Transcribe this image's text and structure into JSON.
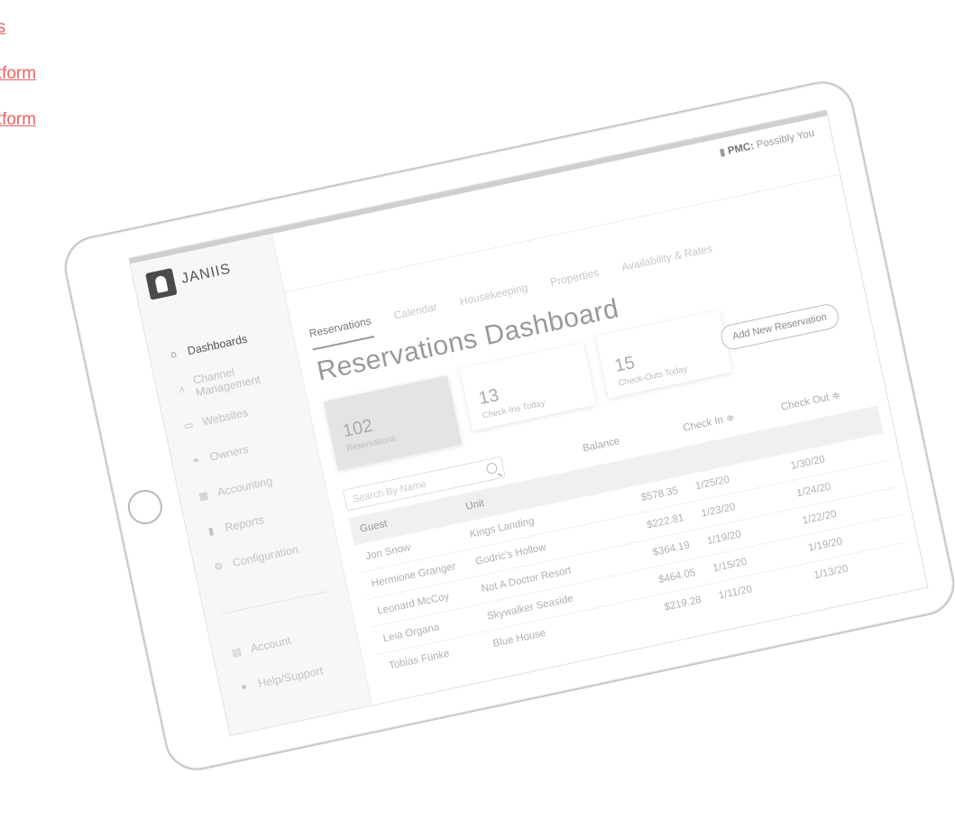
{
  "side_links": [
    "sts",
    "latform",
    "latform"
  ],
  "app": {
    "logo_text": "JANIIS",
    "pmc_label": "PMC:",
    "pmc_value": "Possibly You"
  },
  "sidebar": {
    "items": [
      {
        "label": "Dashboards",
        "icon": "home-icon",
        "active": true
      },
      {
        "label": "Channel Management",
        "icon": "chart-icon"
      },
      {
        "label": "Websites",
        "icon": "monitor-icon"
      },
      {
        "label": "Owners",
        "icon": "handshake-icon"
      },
      {
        "label": "Accounting",
        "icon": "calculator-icon"
      },
      {
        "label": "Reports",
        "icon": "bar-chart-icon"
      },
      {
        "label": "Configuration",
        "icon": "gear-icon"
      }
    ],
    "bottom_items": [
      {
        "label": "Account",
        "icon": "document-icon"
      },
      {
        "label": "Help/Support",
        "icon": "help-icon"
      }
    ]
  },
  "tabs": [
    "Reservations",
    "Calendar",
    "Housekeeping",
    "Properties",
    "Availability & Rates"
  ],
  "page_title": "Reservations Dashboard",
  "stats": [
    {
      "value": "102",
      "label": "Reservations"
    },
    {
      "value": "13",
      "label": "Check-Ins Today"
    },
    {
      "value": "15",
      "label": "Check-Outs Today"
    }
  ],
  "add_button": "Add New Reservation",
  "search_placeholder": "Search By Name",
  "table": {
    "headers": {
      "guest": "Guest",
      "unit": "Unit",
      "balance": "Balance",
      "check_in": "Check In ≑",
      "check_out": "Check Out ≑"
    },
    "rows": [
      {
        "guest": "Jon Snow",
        "unit": "Kings Landing",
        "balance": "$578.35",
        "check_in": "1/25/20",
        "check_out": "1/30/20"
      },
      {
        "guest": "Hermione Granger",
        "unit": "Godric's Hollow",
        "balance": "$222.81",
        "check_in": "1/23/20",
        "check_out": "1/24/20"
      },
      {
        "guest": "Leonard McCoy",
        "unit": "Not A Doctor Resort",
        "balance": "$364.19",
        "check_in": "1/19/20",
        "check_out": "1/22/20"
      },
      {
        "guest": "Leia Organa",
        "unit": "Skywalker Seaside",
        "balance": "$464.05",
        "check_in": "1/15/20",
        "check_out": "1/19/20"
      },
      {
        "guest": "Tobias Fünke",
        "unit": "Blue House",
        "balance": "$219.28",
        "check_in": "1/11/20",
        "check_out": "1/13/20"
      }
    ]
  }
}
